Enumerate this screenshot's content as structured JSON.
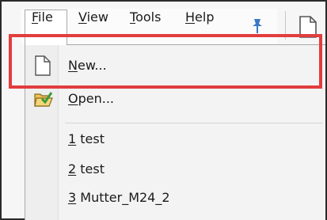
{
  "menubar": {
    "items": [
      {
        "accel": "F",
        "rest": "ile"
      },
      {
        "accel": "V",
        "rest": "iew"
      },
      {
        "accel": "T",
        "rest": "ools"
      },
      {
        "accel": "H",
        "rest": "elp"
      }
    ],
    "pin_icon": "pin-icon",
    "toolbar_icon": "document-icon"
  },
  "file_menu": {
    "new": {
      "accel": "N",
      "rest": "ew...",
      "icon": "new-document-icon"
    },
    "open": {
      "accel": "O",
      "rest": "pen...",
      "icon": "open-folder-icon"
    },
    "recent": [
      {
        "accel": "1",
        "rest": " test"
      },
      {
        "accel": "2",
        "rest": " test"
      },
      {
        "accel": "3",
        "rest": " Mutter_M24_2"
      }
    ]
  },
  "annotation": {
    "highlight_color": "#e23d3d",
    "target": "file-menu-new-item"
  }
}
